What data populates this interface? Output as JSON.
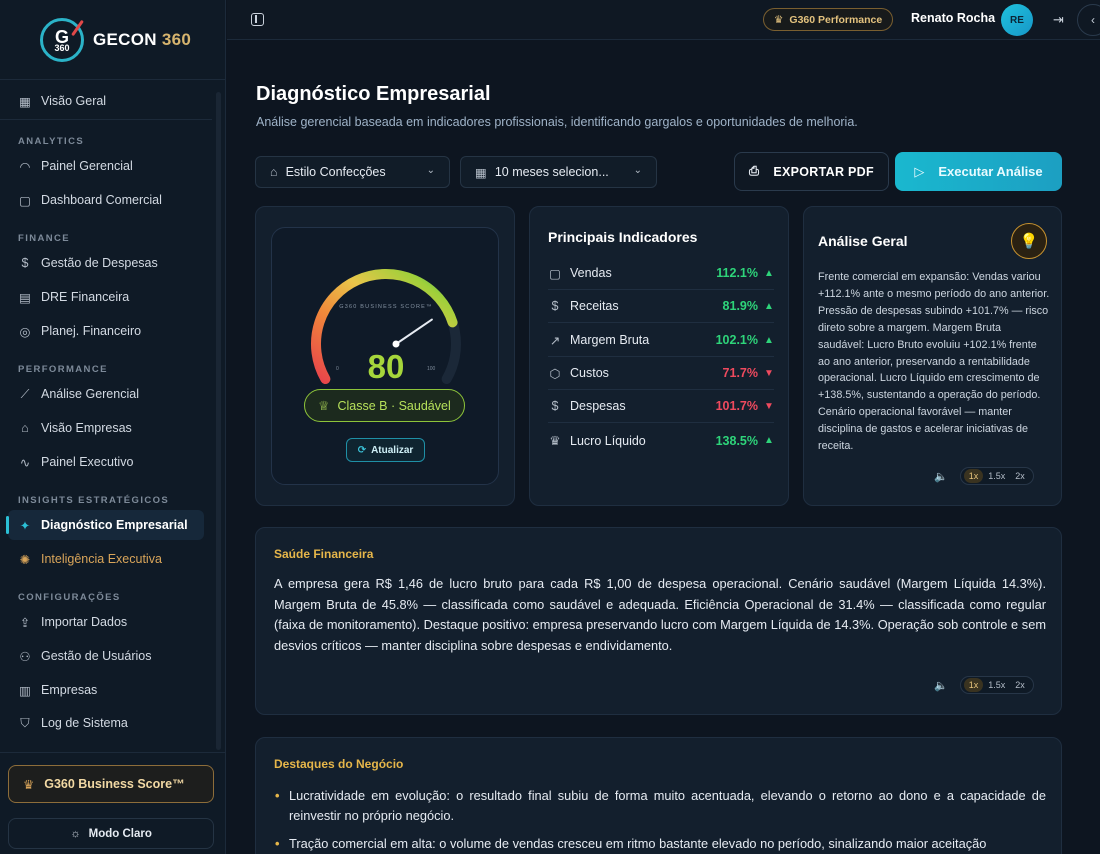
{
  "brand": {
    "mark": "G",
    "mark_sub": "360",
    "name": "GECON",
    "name_num": "360"
  },
  "sidebar": {
    "items": [
      {
        "label": "Visão Geral",
        "icon": "grid-icon"
      },
      {
        "section": "ANALYTICS"
      },
      {
        "label": "Painel Gerencial",
        "icon": "gauge-icon"
      },
      {
        "label": "Dashboard Comercial",
        "icon": "bag-icon"
      },
      {
        "section": "FINANCE"
      },
      {
        "label": "Gestão de Despesas",
        "icon": "dollar-square-icon"
      },
      {
        "label": "DRE Financeira",
        "icon": "file-icon"
      },
      {
        "label": "Planej. Financeiro",
        "icon": "target-icon"
      },
      {
        "section": "PERFORMANCE"
      },
      {
        "label": "Análise Gerencial",
        "icon": "chart-line-icon"
      },
      {
        "label": "Visão Empresas",
        "icon": "store-icon"
      },
      {
        "label": "Painel Executivo",
        "icon": "activity-icon"
      },
      {
        "section": "INSIGHTS ESTRATÉGICOS"
      },
      {
        "label": "Diagnóstico Empresarial",
        "icon": "sparkle-icon",
        "active": true
      },
      {
        "label": "Inteligência Executiva",
        "icon": "brain-icon",
        "accent": true
      },
      {
        "section": "CONFIGURAÇÕES"
      },
      {
        "label": "Importar Dados",
        "icon": "upload-icon"
      },
      {
        "label": "Gestão de Usuários",
        "icon": "users-icon"
      },
      {
        "label": "Empresas",
        "icon": "building-icon"
      },
      {
        "label": "Log de Sistema",
        "icon": "shield-icon"
      }
    ],
    "score_button": "G360 Business Score™",
    "mode_button": "Modo Claro"
  },
  "topbar": {
    "badge": "G360 Performance",
    "user_name": "Renato Rocha",
    "user_initials": "RE"
  },
  "page": {
    "title": "Diagnóstico Empresarial",
    "subtitle": "Análise gerencial baseada em indicadores profissionais, identificando gargalos e oportunidades de melhoria."
  },
  "filters": {
    "company": "Estilo Confecções",
    "period": "10 meses selecion..."
  },
  "actions": {
    "export": "EXPORTAR PDF",
    "run": "Executar Análise"
  },
  "gauge": {
    "caption": "G360 BUSINESS SCORE™",
    "value": 80,
    "value_label": "80",
    "min_label": "0",
    "max_label": "100",
    "class_label": "Classe B · Saudável",
    "refresh_label": "Atualizar"
  },
  "indicators": {
    "title": "Principais Indicadores",
    "rows": [
      {
        "label": "Vendas",
        "value": "112.1%",
        "trend": "up",
        "icon": "bag-icon"
      },
      {
        "label": "Receitas",
        "value": "81.9%",
        "trend": "up",
        "icon": "dollar-icon"
      },
      {
        "label": "Margem Bruta",
        "value": "102.1%",
        "trend": "up",
        "icon": "trend-up-icon"
      },
      {
        "label": "Custos",
        "value": "71.7%",
        "trend": "down",
        "icon": "box-icon"
      },
      {
        "label": "Despesas",
        "value": "101.7%",
        "trend": "down",
        "icon": "dollar-square-icon"
      },
      {
        "label": "Lucro Líquido",
        "value": "138.5%",
        "trend": "up",
        "icon": "trophy-icon"
      }
    ]
  },
  "analysis": {
    "title": "Análise Geral",
    "text": "Frente comercial em expansão: Vendas variou +112.1% ante o mesmo período do ano anterior. Pressão de despesas subindo +101.7% — risco direto sobre a margem. Margem Bruta saudável: Lucro Bruto evoluiu +102.1% frente ao ano anterior, preservando a rentabilidade operacional. Lucro Líquido em crescimento de +138.5%, sustentando a operação do período. Cenário operacional favorável — manter disciplina de gastos e acelerar iniciativas de receita.",
    "speeds": [
      "1x",
      "1.5x",
      "2x"
    ]
  },
  "saude": {
    "title": "Saúde Financeira",
    "text": "A empresa gera R$ 1,46 de lucro bruto para cada R$ 1,00 de despesa operacional. Cenário saudável (Margem Líquida 14.3%). Margem Bruta de 45.8% — classificada como saudável e adequada. Eficiência Operacional de 31.4% — classificada como regular (faixa de monitoramento). Destaque positivo: empresa preservando lucro com Margem Líquida de 14.3%. Operação sob controle e sem desvios críticos — manter disciplina sobre despesas e endividamento.",
    "speeds": [
      "1x",
      "1.5x",
      "2x"
    ]
  },
  "destaques": {
    "title": "Destaques do Negócio",
    "items": [
      "Lucratividade em evolução: o resultado final subiu de forma muito acentuada, elevando o retorno ao dono e a capacidade de reinvestir no próprio negócio.",
      "Tração comercial em alta: o volume de vendas cresceu em ritmo bastante elevado no período, sinalizando maior aceitação"
    ]
  },
  "colors": {
    "accent": "#1ab8cf",
    "gold": "#e6b64a",
    "up": "#2ed47a",
    "down": "#ef4a5e",
    "score": "#a6d63b"
  }
}
